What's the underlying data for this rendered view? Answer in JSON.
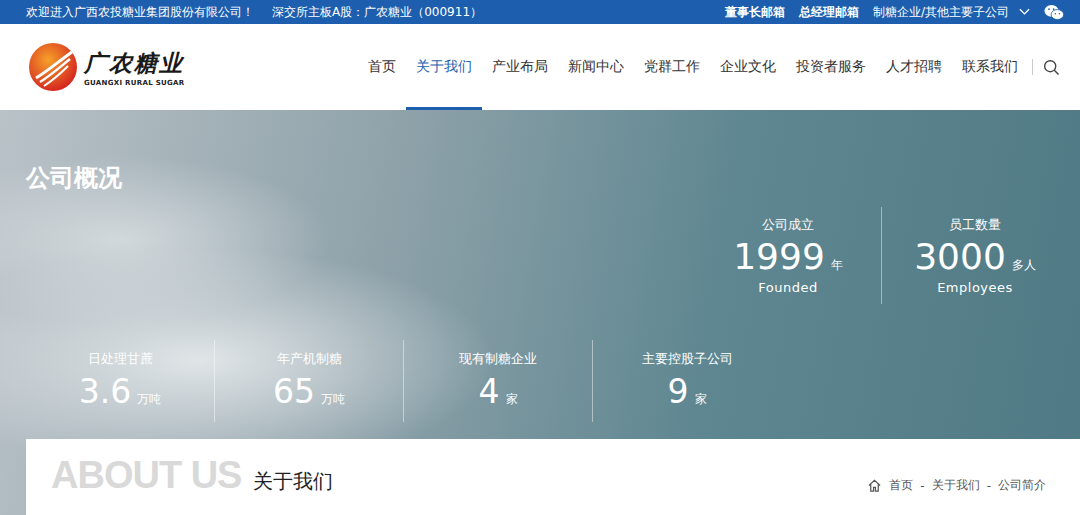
{
  "topbar": {
    "welcome": "欢迎进入广西农投糖业集团股份有限公司！",
    "stock": "深交所主板A股：广农糖业（000911）",
    "links": [
      "董事长邮箱",
      "总经理邮箱"
    ],
    "dropdown": "制糖企业/其他主要子公司"
  },
  "logo": {
    "name": "广农糖业",
    "subtitle": "GUANGXI RURAL SUGAR"
  },
  "nav": [
    {
      "label": "首页",
      "selected": false
    },
    {
      "label": "关于我们",
      "selected": true
    },
    {
      "label": "产业布局",
      "selected": false
    },
    {
      "label": "新闻中心",
      "selected": false
    },
    {
      "label": "党群工作",
      "selected": false
    },
    {
      "label": "企业文化",
      "selected": false
    },
    {
      "label": "投资者服务",
      "selected": false
    },
    {
      "label": "人才招聘",
      "selected": false
    },
    {
      "label": "联系我们",
      "selected": false
    }
  ],
  "hero": {
    "title": "公司概况",
    "top_stats": [
      {
        "label": "公司成立",
        "value": "1999",
        "unit": "年",
        "caption": "Founded"
      },
      {
        "label": "员工数量",
        "value": "3000",
        "unit": "多人",
        "caption": "Employees"
      }
    ],
    "bottom_stats": [
      {
        "label": "日处理甘蔗",
        "value": "3.6",
        "unit": "万吨"
      },
      {
        "label": "年产机制糖",
        "value": "65",
        "unit": "万吨"
      },
      {
        "label": "现有制糖企业",
        "value": "4",
        "unit": "家"
      },
      {
        "label": "主要控股子公司",
        "value": "9",
        "unit": "家"
      }
    ]
  },
  "section": {
    "heading_en": "ABOUT US",
    "heading": "关于我们",
    "breadcrumb": [
      "首页",
      "关于我们",
      "公司简介"
    ],
    "separator": "-"
  }
}
